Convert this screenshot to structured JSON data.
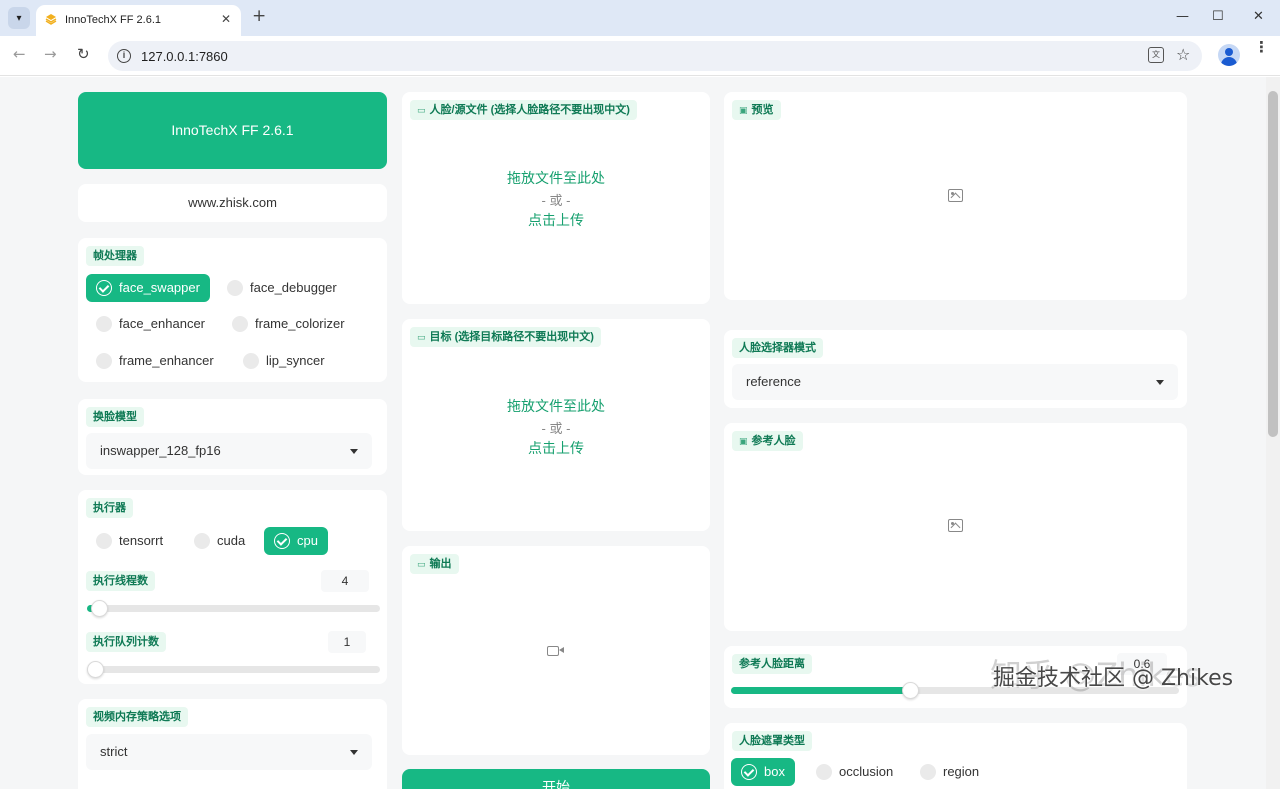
{
  "browser": {
    "tab_title": "InnoTechX FF 2.6.1",
    "url": "127.0.0.1:7860",
    "tab_menu_icon": "▾",
    "close_glyph": "✕",
    "new_tab_glyph": "+",
    "back_glyph": "←",
    "forward_glyph": "→",
    "reload_glyph": "↻",
    "star_glyph": "☆",
    "minimize_glyph": "—",
    "maximize_glyph": "☐",
    "window_close_glyph": "✕",
    "kebab_glyph": "⋮"
  },
  "app": {
    "brand_title": "InnoTechX FF 2.6.1",
    "website": "www.zhisk.com",
    "accent_color": "#17b884",
    "frame_processors": {
      "label": "帧处理器",
      "options": [
        {
          "label": "face_swapper",
          "checked": true
        },
        {
          "label": "face_debugger",
          "checked": false
        },
        {
          "label": "face_enhancer",
          "checked": false
        },
        {
          "label": "frame_colorizer",
          "checked": false
        },
        {
          "label": "frame_enhancer",
          "checked": false
        },
        {
          "label": "lip_syncer",
          "checked": false
        }
      ]
    },
    "face_swapper_model": {
      "label": "换脸模型",
      "value": "inswapper_128_fp16"
    },
    "execution_providers": {
      "label": "执行器",
      "options": [
        {
          "label": "tensorrt",
          "checked": false
        },
        {
          "label": "cuda",
          "checked": false
        },
        {
          "label": "cpu",
          "checked": true
        }
      ]
    },
    "thread_count": {
      "label": "执行线程数",
      "value": "4",
      "fraction": 0.04
    },
    "queue_count": {
      "label": "执行队列计数",
      "value": "1",
      "fraction": 0.0
    },
    "video_memory_strategy": {
      "label": "视频内存策略选项",
      "value": "strict"
    },
    "source": {
      "label": "人脸/源文件 (选择人脸路径不要出现中文)",
      "drop": "拖放文件至此处",
      "or": "- 或 -",
      "click": "点击上传"
    },
    "target": {
      "label": "目标 (选择目标路径不要出现中文)",
      "drop": "拖放文件至此处",
      "or": "- 或 -",
      "click": "点击上传"
    },
    "output": {
      "label": "输出"
    },
    "start_button": "开始",
    "preview": {
      "label": "预览"
    },
    "face_selector_mode": {
      "label": "人脸选择器模式",
      "value": "reference"
    },
    "reference_face": {
      "label": "参考人脸"
    },
    "reference_face_distance": {
      "label": "参考人脸距离",
      "value": "0.6",
      "fraction": 0.4
    },
    "face_mask_types": {
      "label": "人脸遮罩类型",
      "options": [
        {
          "label": "box",
          "checked": true
        },
        {
          "label": "occlusion",
          "checked": false
        },
        {
          "label": "region",
          "checked": false
        }
      ]
    }
  },
  "watermark": {
    "line1": "知乎 @Zhikes",
    "line2": "掘金技术社区 @ Zhikes"
  }
}
